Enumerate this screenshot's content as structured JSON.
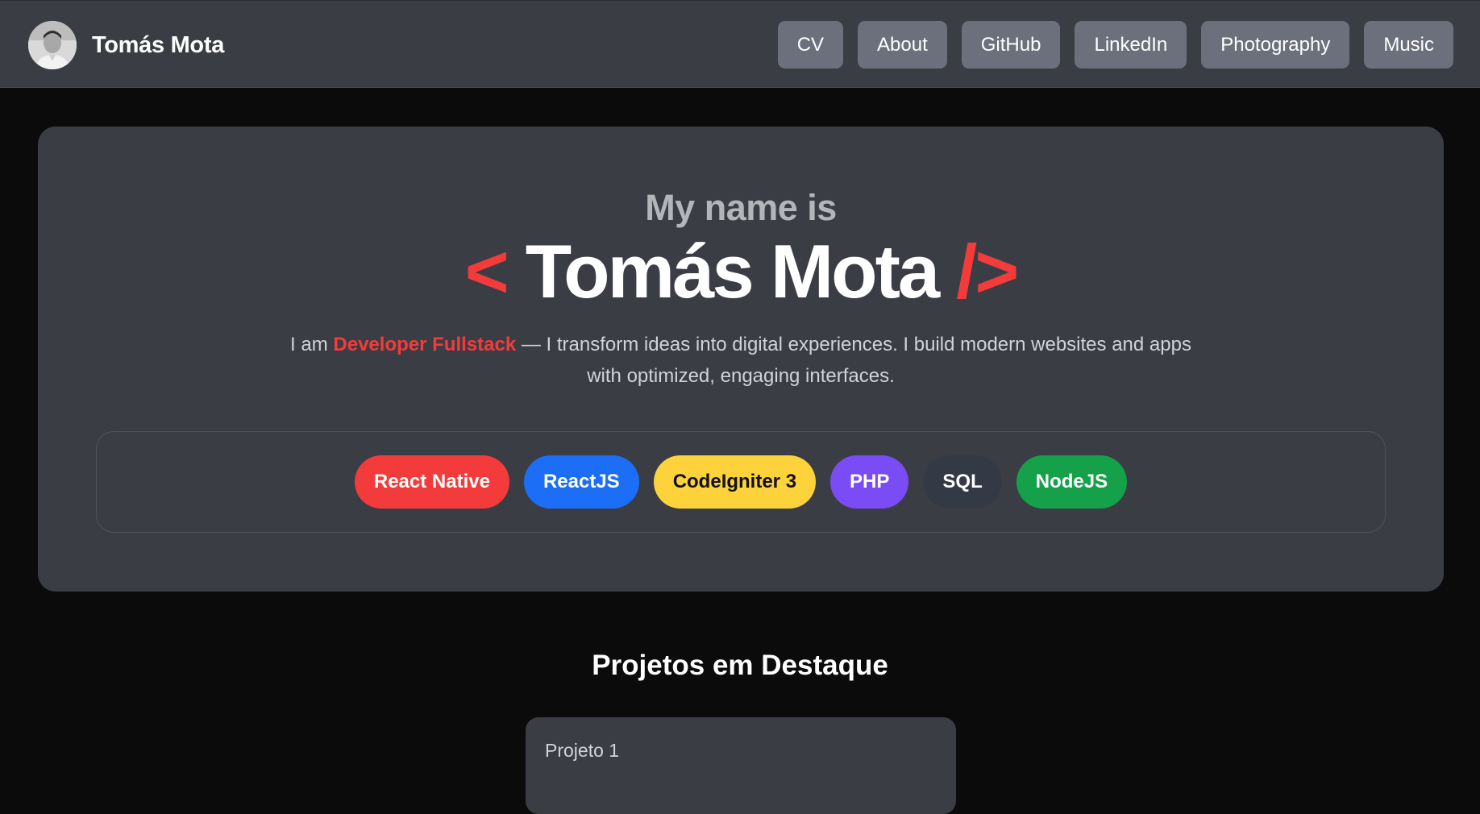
{
  "header": {
    "brand_name": "Tomás Mota",
    "nav": [
      {
        "label": "CV"
      },
      {
        "label": "About"
      },
      {
        "label": "GitHub"
      },
      {
        "label": "LinkedIn"
      },
      {
        "label": "Photography"
      },
      {
        "label": "Music"
      }
    ]
  },
  "hero": {
    "kicker": "My name is",
    "open_bracket": "<",
    "name": "Tomás Mota",
    "close_bracket": "/>",
    "intro_prefix": "I am",
    "role": "Developer Fullstack",
    "intro_suffix": "— I transform ideas into digital experiences. I build modern websites and apps with optimized, engaging interfaces.",
    "tags": [
      {
        "label": "React Native",
        "bg": "#f43b3b",
        "fg": "#ffffff"
      },
      {
        "label": "ReactJS",
        "bg": "#1b6ef5",
        "fg": "#ffffff"
      },
      {
        "label": "CodeIgniter 3",
        "bg": "#fdd23a",
        "fg": "#111111"
      },
      {
        "label": "PHP",
        "bg": "#7a4cf5",
        "fg": "#ffffff"
      },
      {
        "label": "SQL",
        "bg": "#333a46",
        "fg": "#ffffff"
      },
      {
        "label": "NodeJS",
        "bg": "#14a14a",
        "fg": "#ffffff"
      }
    ]
  },
  "projects": {
    "title": "Projetos em Destaque",
    "items": [
      {
        "title": "Projeto 1"
      }
    ]
  },
  "colors": {
    "accent": "#f43b3b",
    "surface": "#3a3d44",
    "background": "#0b0b0c"
  }
}
